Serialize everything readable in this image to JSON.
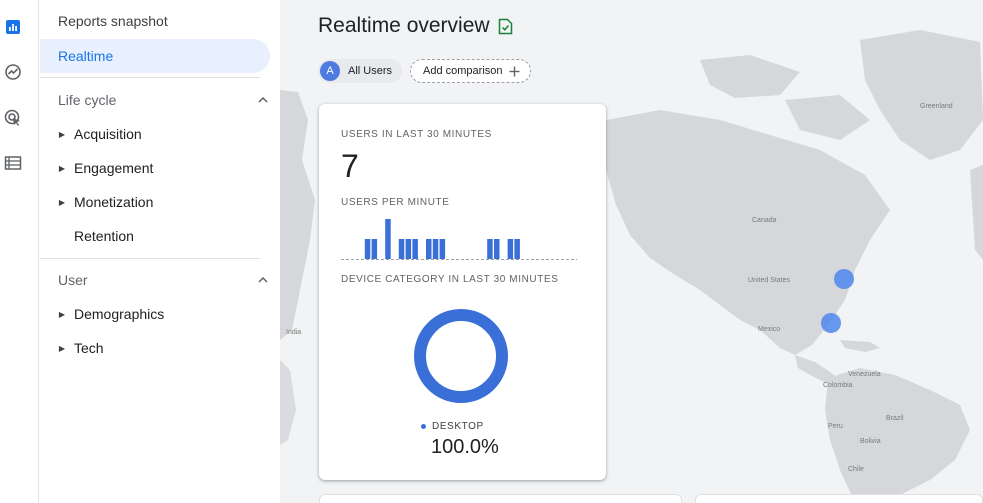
{
  "rail": {
    "items": [
      {
        "icon": "bar-chart-icon",
        "active": true
      },
      {
        "icon": "trend-icon",
        "active": false
      },
      {
        "icon": "target-cursor-icon",
        "active": false
      },
      {
        "icon": "list-icon",
        "active": false
      }
    ]
  },
  "sidebar": {
    "reports_snapshot": "Reports snapshot",
    "realtime": "Realtime",
    "lifecycle": {
      "label": "Life cycle",
      "items": [
        "Acquisition",
        "Engagement",
        "Monetization",
        "Retention"
      ]
    },
    "user": {
      "label": "User",
      "items": [
        "Demographics",
        "Tech"
      ]
    }
  },
  "header": {
    "title": "Realtime overview"
  },
  "comparison": {
    "avatar_letter": "A",
    "segment": "All Users",
    "add_label": "Add comparison"
  },
  "card": {
    "users_label": "USERS IN LAST 30 MINUTES",
    "users_value": "7",
    "per_minute_label": "USERS PER MINUTE",
    "per_minute_bars": [
      0,
      1,
      1,
      0,
      2,
      0,
      1,
      1,
      1,
      0,
      1,
      1,
      1,
      0,
      0,
      0,
      0,
      0,
      0,
      1,
      1,
      0,
      1,
      1,
      0,
      0
    ],
    "device_label": "DEVICE CATEGORY IN LAST 30 MINUTES",
    "device_legend": "DESKTOP",
    "device_value": "100.0%"
  },
  "map": {
    "labels": {
      "greenland": "Greenland",
      "canada": "Canada",
      "united_states": "United States",
      "mexico": "Mexico",
      "venezuela": "Venezuela",
      "colombia": "Colombia",
      "peru": "Peru",
      "brazil": "Brazil",
      "bolivia": "Bolivia",
      "chile": "Chile",
      "india": "India"
    }
  },
  "colors": {
    "accent": "#1a73e8",
    "bar": "#3a6fd8",
    "map_land": "#d5d7da",
    "map_water": "#f1f3f4",
    "bubble": "#4f86ec"
  }
}
